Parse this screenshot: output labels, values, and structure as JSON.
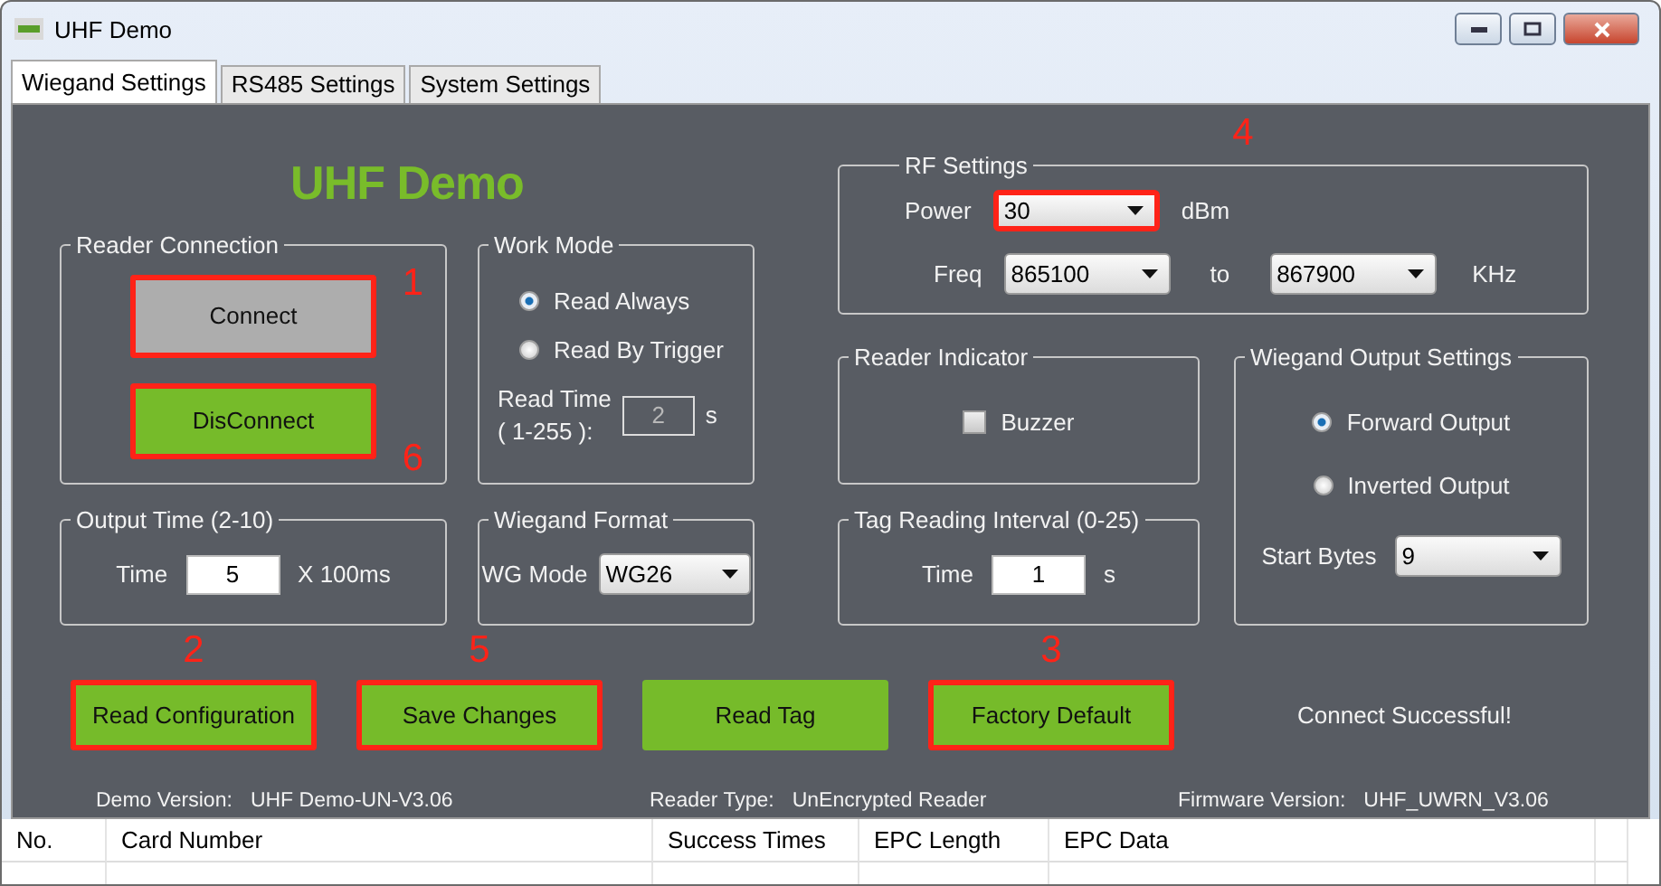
{
  "window": {
    "title": "UHF Demo"
  },
  "tabs": [
    {
      "label": "Wiegand Settings",
      "selected": true
    },
    {
      "label": "RS485 Settings",
      "selected": false
    },
    {
      "label": "System Settings",
      "selected": false
    }
  ],
  "heading": "UHF Demo",
  "reader_connection": {
    "title": "Reader Connection",
    "buttons": [
      {
        "label": "Connect",
        "disabled": true,
        "highlighted": true,
        "callout": "1"
      },
      {
        "label": "DisConnect",
        "disabled": false,
        "highlighted": true,
        "callout": "6"
      }
    ]
  },
  "work_mode": {
    "title": "Work Mode",
    "options": [
      {
        "label": "Read Always",
        "selected": true
      },
      {
        "label": "Read By Trigger",
        "selected": false
      }
    ],
    "read_time": {
      "label": "Read Time",
      "range": "( 1-255 ):",
      "value": "2",
      "disabled": true,
      "unit": "s"
    }
  },
  "output_time": {
    "title": "Output Time (2-10)",
    "label": "Time",
    "value": "5",
    "unit": "X 100ms"
  },
  "wiegand_format": {
    "title": "Wiegand Format",
    "label": "WG Mode",
    "value": "WG26"
  },
  "rf_settings": {
    "title": "RF Settings",
    "callout": "4",
    "power": {
      "label": "Power",
      "value": "30",
      "unit": "dBm",
      "highlighted": true
    },
    "freq": {
      "label": "Freq",
      "from": "865100",
      "to_label": "to",
      "to": "867900",
      "unit": "KHz"
    }
  },
  "reader_indicator": {
    "title": "Reader Indicator",
    "buzzer": {
      "label": "Buzzer",
      "checked": false
    }
  },
  "tag_interval": {
    "title": "Tag Reading Interval (0-25)",
    "label": "Time",
    "value": "1",
    "unit": "s"
  },
  "wiegand_output": {
    "title": "Wiegand Output Settings",
    "options": [
      {
        "label": "Forward Output",
        "selected": true
      },
      {
        "label": "Inverted Output",
        "selected": false
      }
    ],
    "start_bytes": {
      "label": "Start Bytes",
      "value": "9"
    }
  },
  "actions": [
    {
      "label": "Read Configuration",
      "highlighted": true,
      "callout": "2"
    },
    {
      "label": "Save Changes",
      "highlighted": true,
      "callout": "5"
    },
    {
      "label": "Read Tag",
      "highlighted": false
    },
    {
      "label": "Factory Default",
      "highlighted": true,
      "callout": "3"
    }
  ],
  "status": "Connect Successful!",
  "info": [
    {
      "label": "Demo Version:",
      "value": "UHF Demo-UN-V3.06"
    },
    {
      "label": "Reader Type:",
      "value": "UnEncrypted Reader"
    },
    {
      "label": "Firmware Version:",
      "value": "UHF_UWRN_V3.06"
    }
  ],
  "table": {
    "columns": [
      "No.",
      "Card Number",
      "Success Times",
      "EPC Length",
      "EPC Data"
    ]
  }
}
